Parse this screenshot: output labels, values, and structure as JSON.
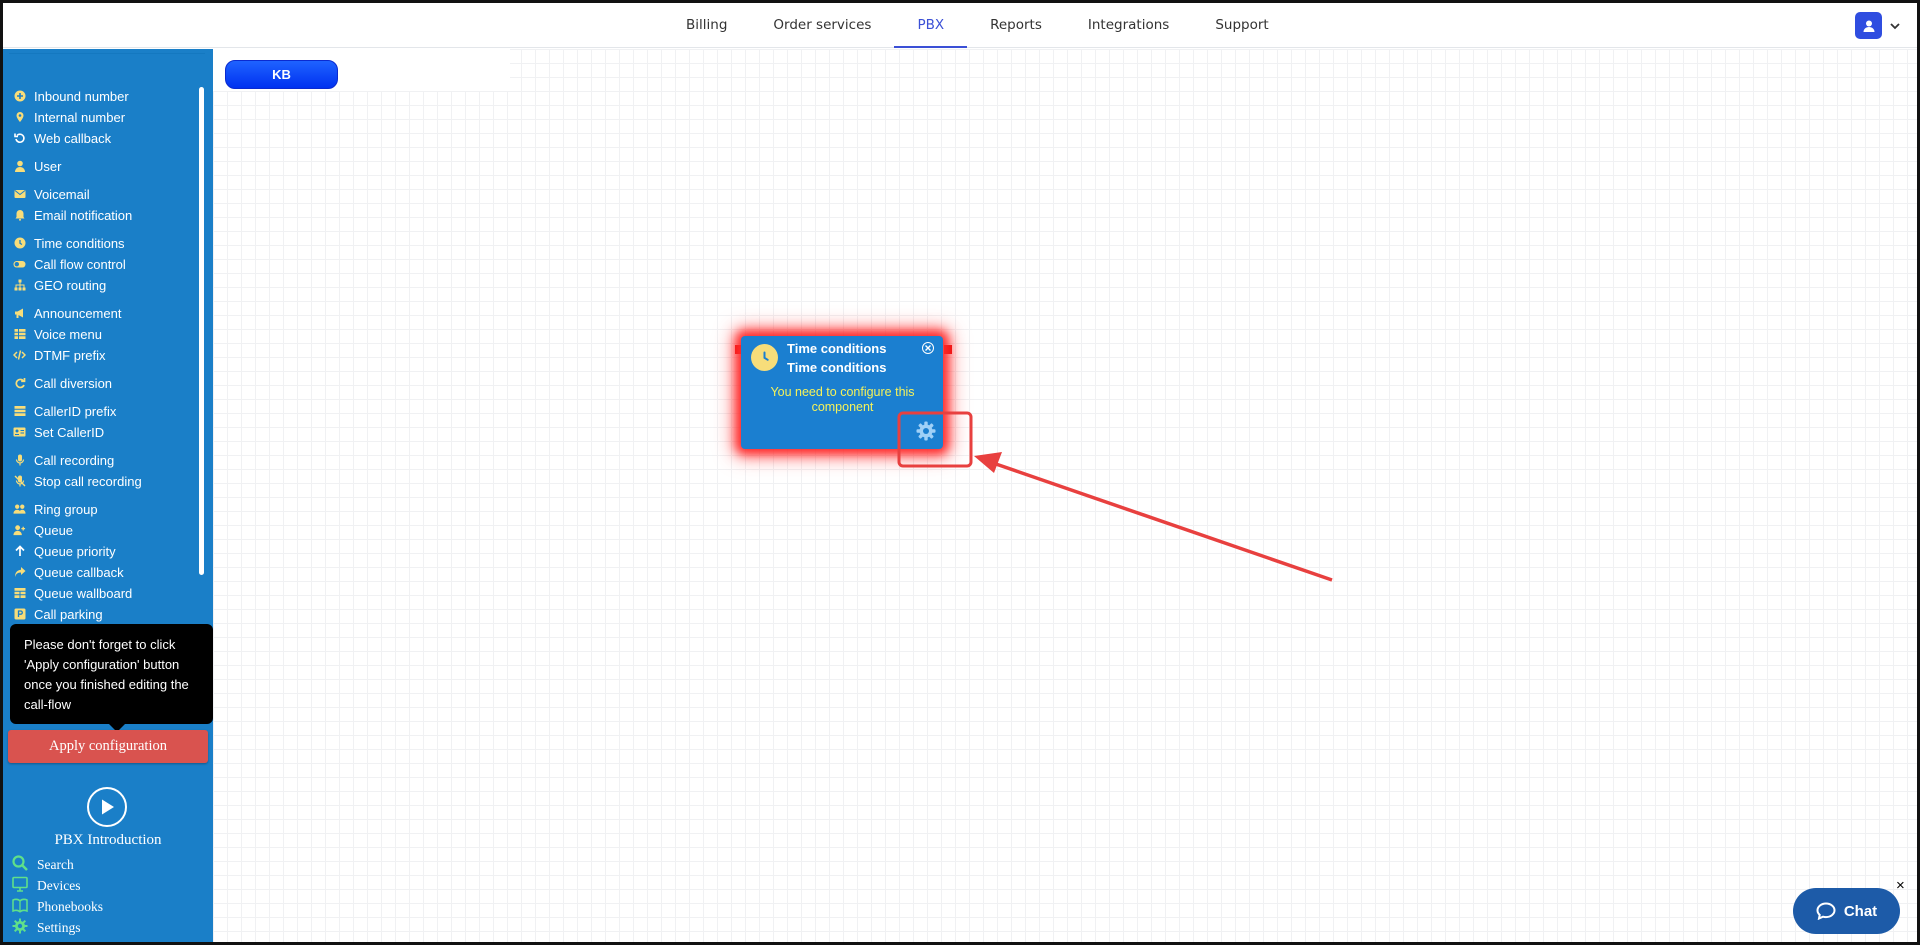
{
  "topnav": {
    "tabs": [
      {
        "label": "Billing"
      },
      {
        "label": "Order services"
      },
      {
        "label": "PBX"
      },
      {
        "label": "Reports"
      },
      {
        "label": "Integrations"
      },
      {
        "label": "Support"
      }
    ],
    "active_tab": "PBX"
  },
  "sidebar": {
    "items": [
      {
        "label": "Inbound number",
        "icon": "plus-circle-icon"
      },
      {
        "label": "Internal number",
        "icon": "map-pin-icon"
      },
      {
        "label": "Web callback",
        "icon": "undo-icon"
      },
      {
        "label": "User",
        "icon": "user-icon"
      },
      {
        "label": "Voicemail",
        "icon": "envelope-icon"
      },
      {
        "label": "Email notification",
        "icon": "bell-icon"
      },
      {
        "label": "Time conditions",
        "icon": "clock-icon"
      },
      {
        "label": "Call flow control",
        "icon": "toggle-icon"
      },
      {
        "label": "GEO routing",
        "icon": "sitemap-icon"
      },
      {
        "label": "Announcement",
        "icon": "megaphone-icon"
      },
      {
        "label": "Voice menu",
        "icon": "grid-icon"
      },
      {
        "label": "DTMF prefix",
        "icon": "code-icon"
      },
      {
        "label": "Call diversion",
        "icon": "redo-icon"
      },
      {
        "label": "CallerID prefix",
        "icon": "list-icon"
      },
      {
        "label": "Set CallerID",
        "icon": "id-card-icon"
      },
      {
        "label": "Call recording",
        "icon": "microphone-icon"
      },
      {
        "label": "Stop call recording",
        "icon": "microphone-slash-icon"
      },
      {
        "label": "Ring group",
        "icon": "users-icon"
      },
      {
        "label": "Queue",
        "icon": "user-plus-icon"
      },
      {
        "label": "Queue priority",
        "icon": "arrow-up-icon"
      },
      {
        "label": "Queue callback",
        "icon": "share-icon"
      },
      {
        "label": "Queue wallboard",
        "icon": "table-icon"
      },
      {
        "label": "Call parking",
        "icon": "parking-icon"
      }
    ],
    "tooltip": "Please don't forget to click 'Apply configuration' button once you finished editing the call-flow",
    "apply_label": "Apply configuration",
    "intro_label": "PBX Introduction",
    "bottom_items": [
      {
        "label": "Search",
        "icon": "search-icon"
      },
      {
        "label": "Devices",
        "icon": "monitor-icon"
      },
      {
        "label": "Phonebooks",
        "icon": "book-icon"
      },
      {
        "label": "Settings",
        "icon": "gear-icon"
      }
    ]
  },
  "canvas": {
    "kb_label": "KB",
    "node": {
      "title": "Time conditions",
      "subtitle": "Time conditions",
      "message": "You need to configure this component"
    }
  },
  "chat": {
    "label": "Chat",
    "close": "×"
  },
  "colors": {
    "sidebar_bg": "#1a7fc8",
    "node_bg": "#1b7fd0",
    "node_glow": "#ff2a2a",
    "apply_bg": "#d9534f",
    "active_tab": "#3b50d6",
    "annotation": "#e8403f",
    "chat_bg": "#1d5ba8"
  }
}
